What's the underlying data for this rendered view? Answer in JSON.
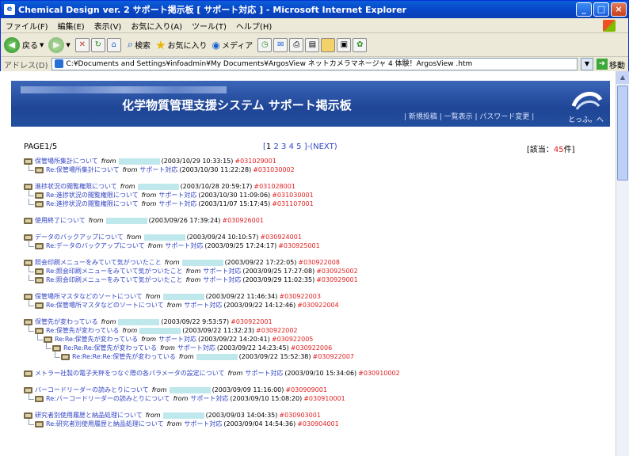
{
  "window": {
    "title": "Chemical Design ver. 2 サポート掲示板 [ サポート対応 ] - Microsoft Internet Explorer"
  },
  "menu": [
    "ファイル(F)",
    "編集(E)",
    "表示(V)",
    "お気に入り(A)",
    "ツール(T)",
    "ヘルプ(H)"
  ],
  "toolbar": {
    "back": "戻る",
    "search": "検索",
    "favorites": "お気に入り",
    "media": "メディア"
  },
  "address": {
    "label": "アドレス(D)",
    "value": "C:¥Documents and Settings¥infoadmin¥My Documents¥ArgosView ネットカメラマネージャ  4  体験！ArgosView .htm",
    "go": "移動"
  },
  "banner": {
    "heading": "化学物質管理支援システム サポート掲示板",
    "links": "| 新規投稿 | 一覧表示 | パスワード変更 |",
    "logo_text": "とっふ。へ"
  },
  "pager": {
    "page_label": "PAGE1/5",
    "open": "[",
    "current": "1",
    "pages": [
      "2",
      "3",
      "4",
      "5"
    ],
    "next": "]-(NEXT)",
    "hits_prefix": "[該当：",
    "hits_count": "45",
    "hits_suffix": "件]"
  },
  "threads": [
    {
      "posts": [
        {
          "subject": "保管場所集計について",
          "from": "from",
          "author": "",
          "date": "(2003/10/29 10:33:15)",
          "id": "#031029001"
        },
        {
          "subject": "Re:保管場所集計について",
          "from": "from",
          "author": "サポート対応",
          "date": "(2003/10/30 11:22:28)",
          "id": "#031030002"
        }
      ]
    },
    {
      "posts": [
        {
          "subject": "進捗状況の閲覧権限について",
          "from": "from",
          "author": "",
          "date": "(2003/10/28 20:59:17)",
          "id": "#031028001"
        },
        {
          "subject": "Re:進捗状況の閲覧権限について",
          "from": "from",
          "author": "サポート対応",
          "date": "(2003/10/30 11:09:06)",
          "id": "#031030001"
        },
        {
          "subject": "Re:進捗状況の閲覧権限について",
          "from": "from",
          "author": "サポート対応",
          "date": "(2003/11/07 15:17:45)",
          "id": "#031107001"
        }
      ]
    },
    {
      "posts": [
        {
          "subject": "使用終了について",
          "from": "from",
          "author": "",
          "date": "(2003/09/26 17:39:24)",
          "id": "#030926001"
        }
      ]
    },
    {
      "posts": [
        {
          "subject": "データのバックアップについて",
          "from": "from",
          "author": "",
          "date": "(2003/09/24 10:10:57)",
          "id": "#030924001"
        },
        {
          "subject": "Re:データのバックアップについて",
          "from": "from",
          "author": "サポート対応",
          "date": "(2003/09/25 17:24:17)",
          "id": "#030925001"
        }
      ]
    },
    {
      "posts": [
        {
          "subject": "照会印刷メニューをみていて気がついたこと",
          "from": "from",
          "author": "",
          "date": "(2003/09/22 17:22:05)",
          "id": "#030922008"
        },
        {
          "subject": "Re:照会印刷メニューをみていて気がついたこと",
          "from": "from",
          "author": "サポート対応",
          "date": "(2003/09/25 17:27:08)",
          "id": "#030925002"
        },
        {
          "subject": "Re:照会印刷メニューをみていて気がついたこと",
          "from": "from",
          "author": "サポート対応",
          "date": "(2003/09/29 11:02:35)",
          "id": "#030929001"
        }
      ]
    },
    {
      "posts": [
        {
          "subject": "保管場所マスタなどのソートについて",
          "from": "from",
          "author": "",
          "date": "(2003/09/22 11:46:34)",
          "id": "#030922003"
        },
        {
          "subject": "Re:保管場所マスタなどのソートについて",
          "from": "from",
          "author": "サポート対応",
          "date": "(2003/09/22 14:12:46)",
          "id": "#030922004"
        }
      ]
    },
    {
      "posts": [
        {
          "subject": "保管先が変わっている",
          "from": "from",
          "author": "",
          "date": "(2003/09/22 9:53:57)",
          "id": "#030922001"
        },
        {
          "subject": "Re:保管先が変わっている",
          "from": "from",
          "author": "",
          "date": "(2003/09/22 11:32:23)",
          "id": "#030922002"
        },
        {
          "subject": "Re:Re:保管先が変わっている",
          "from": "from",
          "author": "サポート対応",
          "date": "(2003/09/22 14:20:41)",
          "id": "#030922005"
        },
        {
          "subject": "Re:Re:Re:保管先が変わっている",
          "from": "from",
          "author": "サポート対応",
          "date": "(2003/09/22 14:23:45)",
          "id": "#030922006"
        },
        {
          "subject": "Re:Re:Re:Re:保管先が変わっている",
          "from": "from",
          "author": "",
          "date": "(2003/09/22 15:52:38)",
          "id": "#030922007"
        }
      ]
    },
    {
      "posts": [
        {
          "subject": "メトラー社製の電子天秤をつなぐ際の各パラメータの設定について",
          "from": "from",
          "author": "サポート対応",
          "date": "(2003/09/10 15:34:06)",
          "id": "#030910002"
        }
      ]
    },
    {
      "posts": [
        {
          "subject": "バーコードリーダーの読みとりについて",
          "from": "from",
          "author": "",
          "date": "(2003/09/09 11:16:00)",
          "id": "#030909001"
        },
        {
          "subject": "Re:バーコードリーダーの読みとりについて",
          "from": "from",
          "author": "サポート対応",
          "date": "(2003/09/10 15:08:20)",
          "id": "#030910001"
        }
      ]
    },
    {
      "posts": [
        {
          "subject": "研究者別使用履歴と納品処理について",
          "from": "from",
          "author": "",
          "date": "(2003/09/03 14:04:35)",
          "id": "#030903001"
        },
        {
          "subject": "Re:研究者別使用履歴と納品処理について",
          "from": "from",
          "author": "サポート対応",
          "date": "(2003/09/04 14:54:36)",
          "id": "#030904001"
        }
      ]
    }
  ]
}
